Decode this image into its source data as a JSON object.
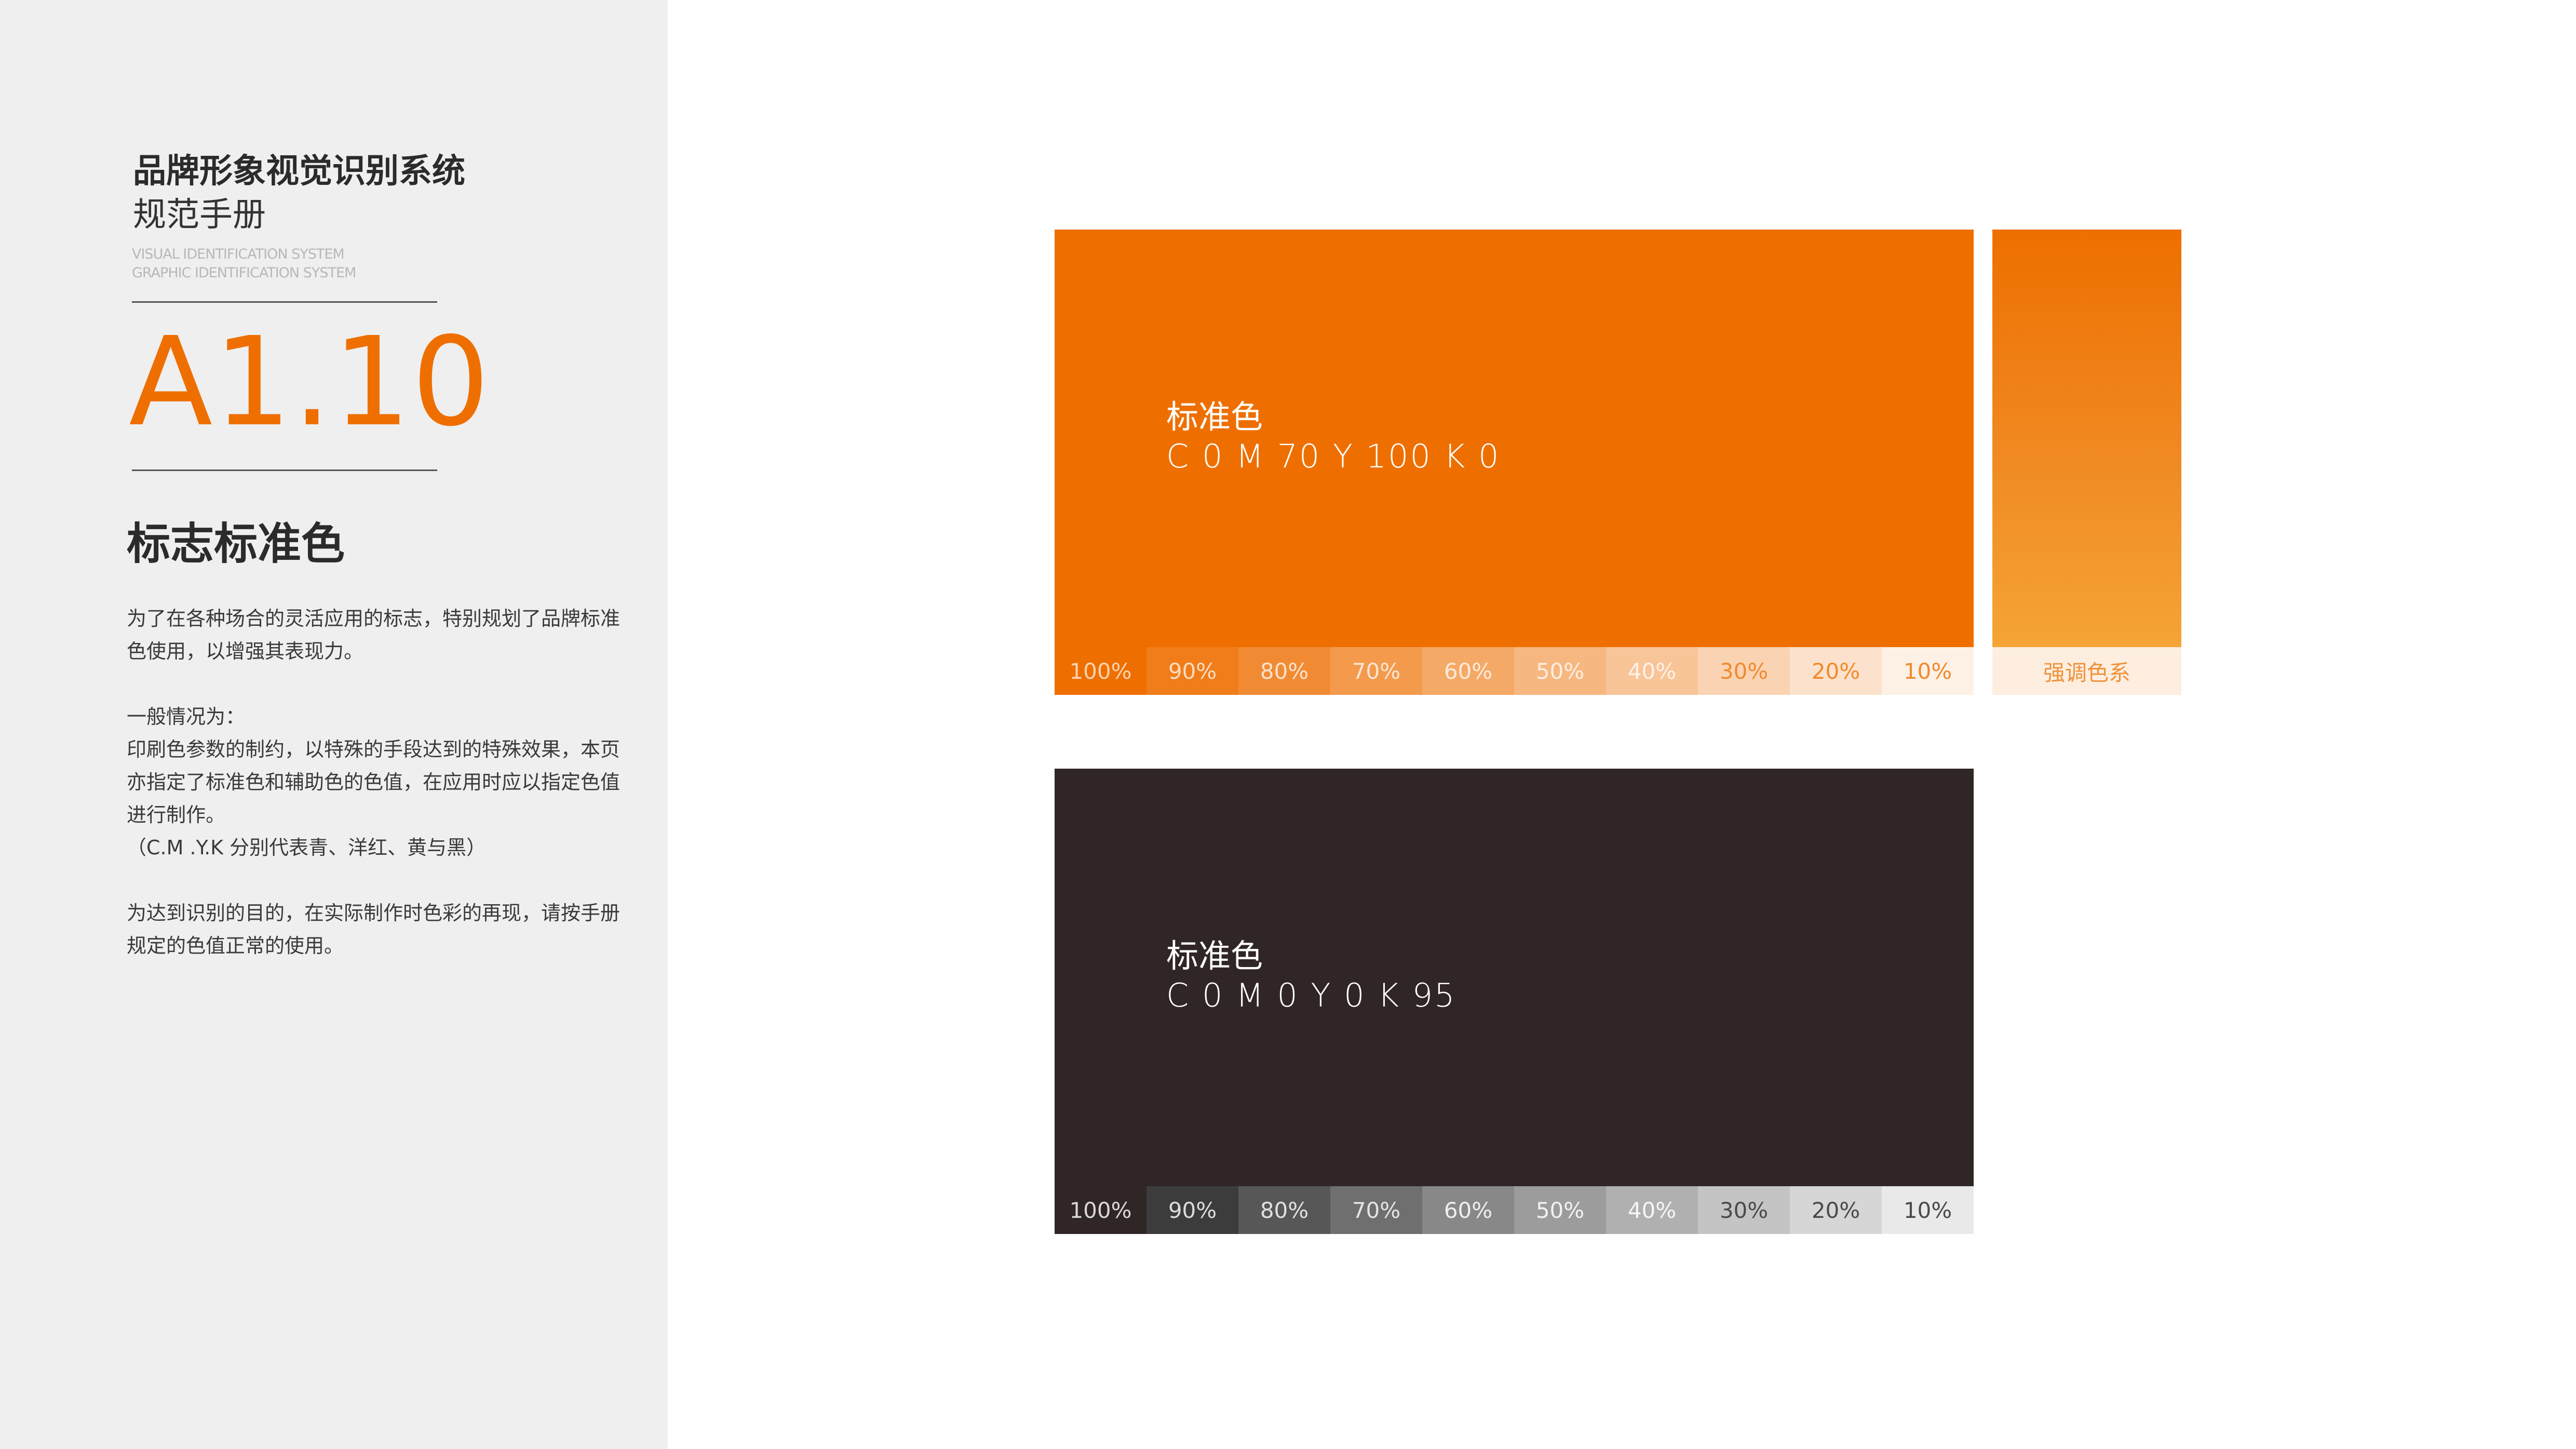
{
  "sidebar": {
    "title_line1": "品牌形象视觉识别系统",
    "title_line2": "规范手册",
    "en_line1": "VISUAL IDENTIFICATION SYSTEM",
    "en_line2": "GRAPHIC IDENTIFICATION SYSTEM",
    "section_number": "A1.10",
    "section_title": "标志标准色",
    "description": {
      "para1": "为了在各种场合的灵活应用的标志，特别规划了品牌标准色使用，以增强其表现力。",
      "para2_heading": "一般情况为：",
      "para2_body": "印刷色参数的制约，以特殊的手段达到的特殊效果，本页亦指定了标准色和辅助色的色值，在应用时应以指定色值进行制作。",
      "para2_note": "（C.M .Y.K 分别代表青、洋红、黄与黑）",
      "para3": "为达到识别的目的，在实际制作时色彩的再现，请按手册规定的色值正常的使用。"
    }
  },
  "orange_swatch": {
    "name": "标准色",
    "code": "C 0 M 70 Y 100 K 0",
    "color": "#ee6f00",
    "tints": [
      {
        "label": "100%",
        "color": "#ee6f00",
        "text_color": "#fbd3b0"
      },
      {
        "label": "90%",
        "color": "#f07d19",
        "text_color": "#fcdcc0"
      },
      {
        "label": "80%",
        "color": "#f18b33",
        "text_color": "#fde2cc"
      },
      {
        "label": "70%",
        "color": "#f39a4d",
        "text_color": "#fde6d3"
      },
      {
        "label": "60%",
        "color": "#f5a966",
        "text_color": "#feead9"
      },
      {
        "label": "50%",
        "color": "#f6b780",
        "text_color": "#feeee0"
      },
      {
        "label": "40%",
        "color": "#f8c599",
        "text_color": "#fff2e6"
      },
      {
        "label": "30%",
        "color": "#fad3b3",
        "text_color": "#f08a2e"
      },
      {
        "label": "20%",
        "color": "#fce2cc",
        "text_color": "#f08a2e"
      },
      {
        "label": "10%",
        "color": "#fdf1e6",
        "text_color": "#f08a2e"
      }
    ]
  },
  "accent_swatch": {
    "label": "强调色系",
    "color_top": "#ee6f00",
    "color_bottom": "#f5a436"
  },
  "dark_swatch": {
    "name": "标准色",
    "code": "C 0 M 0 Y 0 K 95",
    "color": "#302625",
    "tints": [
      {
        "label": "100%",
        "color": "#302625",
        "text_color": "#d8d8d8"
      },
      {
        "label": "90%",
        "color": "#3c3c3c",
        "text_color": "#dcdcdc"
      },
      {
        "label": "80%",
        "color": "#575757",
        "text_color": "#e0e0e0"
      },
      {
        "label": "70%",
        "color": "#6f6f6f",
        "text_color": "#e4e4e4"
      },
      {
        "label": "60%",
        "color": "#888888",
        "text_color": "#eeeeee"
      },
      {
        "label": "50%",
        "color": "#9c9c9c",
        "text_color": "#f2f2f2"
      },
      {
        "label": "40%",
        "color": "#b0b0b0",
        "text_color": "#f6f6f6"
      },
      {
        "label": "30%",
        "color": "#c4c4c4",
        "text_color": "#4a4a4a"
      },
      {
        "label": "20%",
        "color": "#d6d6d6",
        "text_color": "#4a4a4a"
      },
      {
        "label": "10%",
        "color": "#e9e9e9",
        "text_color": "#4a4a4a"
      }
    ]
  }
}
